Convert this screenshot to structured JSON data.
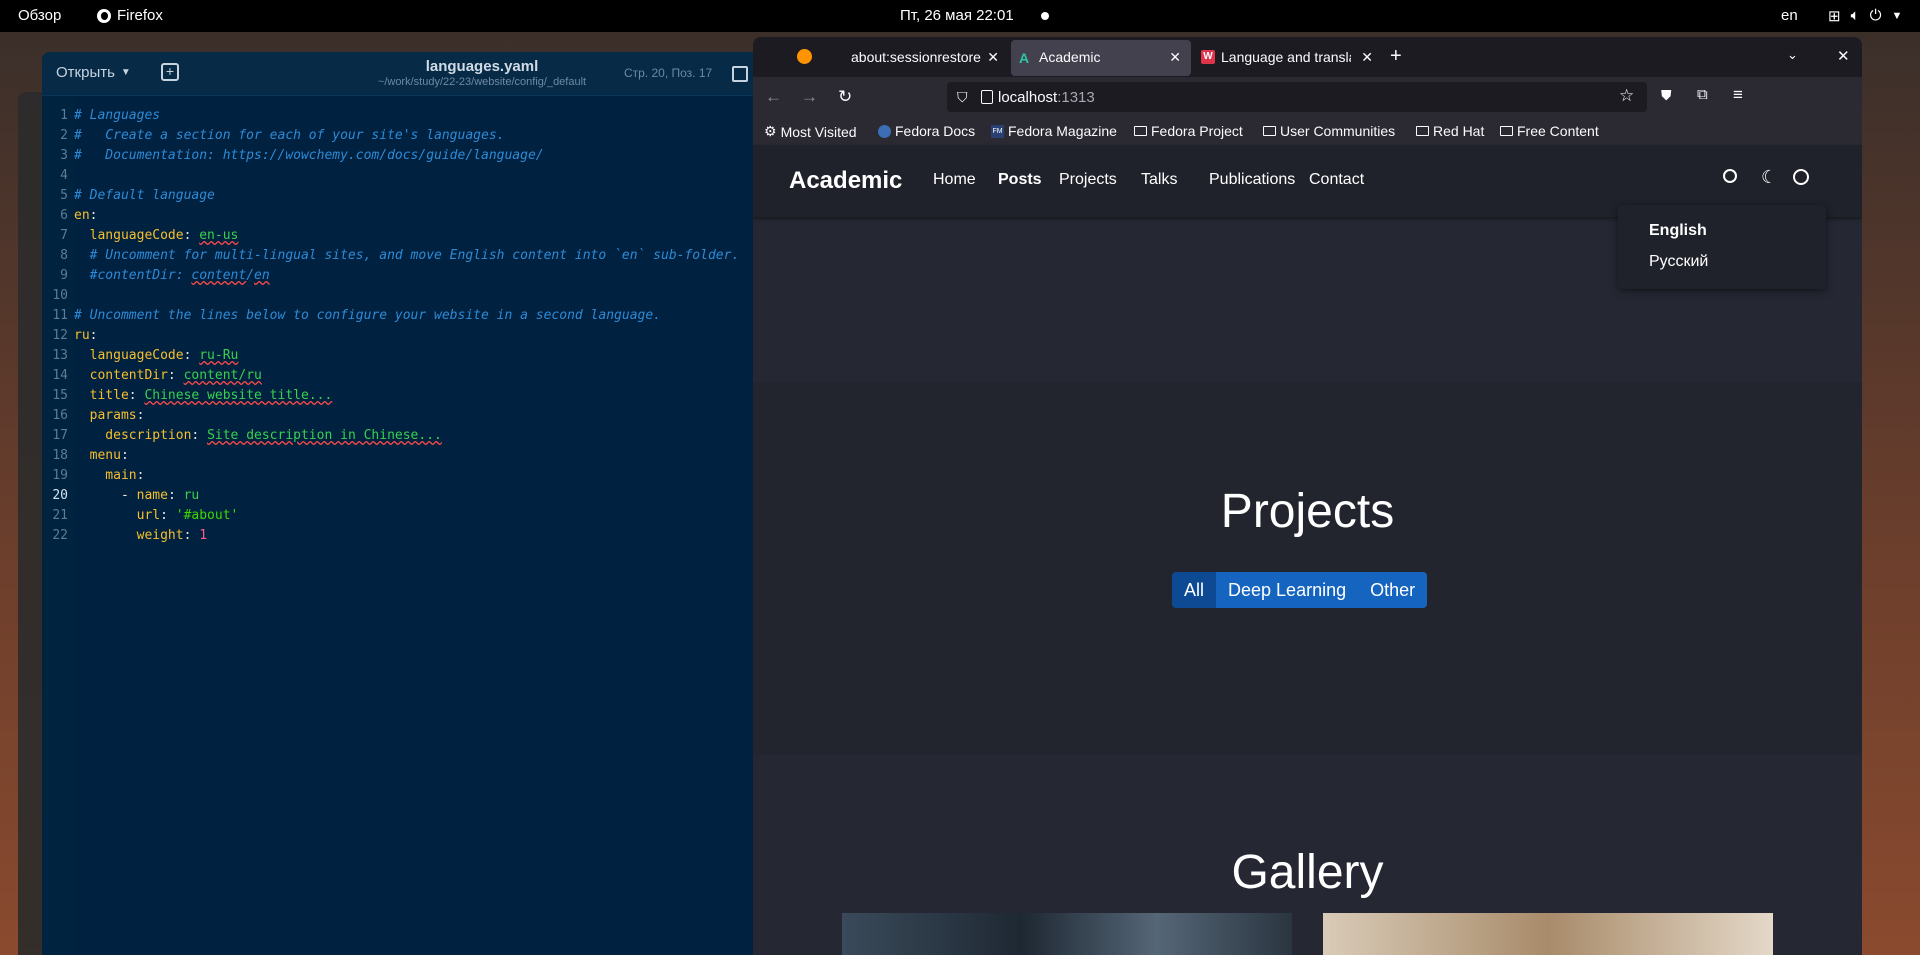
{
  "topbar": {
    "activities": "Обзор",
    "app_name": "Firefox",
    "clock": "Пт, 26 мая  22:01",
    "keyboard_layout": "en"
  },
  "gedit": {
    "open_label": "Открыть",
    "title": "languages.yaml",
    "path": "~/work/study/22-23/website/config/_default",
    "cursor_position": "Стр. 20, Поз. 17",
    "lines": [
      {
        "n": "1",
        "segments": [
          {
            "t": "# Languages",
            "c": "c-com"
          }
        ]
      },
      {
        "n": "2",
        "segments": [
          {
            "t": "#   Create a section for each of your site's languages.",
            "c": "c-com"
          }
        ]
      },
      {
        "n": "3",
        "segments": [
          {
            "t": "#   Documentation: https://wowchemy.com/docs/guide/language/",
            "c": "c-com"
          }
        ]
      },
      {
        "n": "4",
        "segments": []
      },
      {
        "n": "5",
        "segments": [
          {
            "t": "# Default language",
            "c": "c-com"
          }
        ]
      },
      {
        "n": "6",
        "segments": [
          {
            "t": "en",
            "c": "c-key"
          },
          {
            "t": ":",
            "c": "c-punct"
          }
        ]
      },
      {
        "n": "7",
        "segments": [
          {
            "t": "  languageCode",
            "c": "c-key"
          },
          {
            "t": ": ",
            "c": "c-punct"
          },
          {
            "t": "en-us",
            "c": "c-str c-u"
          }
        ]
      },
      {
        "n": "8",
        "segments": [
          {
            "t": "  # Uncomment for multi-lingual sites, and move English content into `en` sub-folder.",
            "c": "c-com"
          }
        ]
      },
      {
        "n": "9",
        "segments": [
          {
            "t": "  #contentDir: ",
            "c": "c-com"
          },
          {
            "t": "content",
            "c": "c-com c-u"
          },
          {
            "t": "/",
            "c": "c-com"
          },
          {
            "t": "en",
            "c": "c-com c-u"
          }
        ]
      },
      {
        "n": "10",
        "segments": []
      },
      {
        "n": "11",
        "segments": [
          {
            "t": "# Uncomment the lines below to configure your website in a second language.",
            "c": "c-com"
          }
        ]
      },
      {
        "n": "12",
        "segments": [
          {
            "t": "ru",
            "c": "c-key"
          },
          {
            "t": ":",
            "c": "c-punct"
          }
        ]
      },
      {
        "n": "13",
        "segments": [
          {
            "t": "  languageCode",
            "c": "c-key"
          },
          {
            "t": ": ",
            "c": "c-punct"
          },
          {
            "t": "ru-Ru",
            "c": "c-str c-u"
          }
        ]
      },
      {
        "n": "14",
        "segments": [
          {
            "t": "  contentDir",
            "c": "c-key"
          },
          {
            "t": ": ",
            "c": "c-punct"
          },
          {
            "t": "content/ru",
            "c": "c-str c-u"
          }
        ]
      },
      {
        "n": "15",
        "segments": [
          {
            "t": "  title",
            "c": "c-key"
          },
          {
            "t": ": ",
            "c": "c-punct"
          },
          {
            "t": "Chinese website title...",
            "c": "c-str c-u"
          }
        ]
      },
      {
        "n": "16",
        "segments": [
          {
            "t": "  params",
            "c": "c-key"
          },
          {
            "t": ":",
            "c": "c-punct"
          }
        ]
      },
      {
        "n": "17",
        "segments": [
          {
            "t": "    description",
            "c": "c-key"
          },
          {
            "t": ": ",
            "c": "c-punct"
          },
          {
            "t": "Site description in Chinese...",
            "c": "c-str c-u"
          }
        ]
      },
      {
        "n": "18",
        "segments": [
          {
            "t": "  menu",
            "c": "c-key"
          },
          {
            "t": ":",
            "c": "c-punct"
          }
        ]
      },
      {
        "n": "19",
        "segments": [
          {
            "t": "    main",
            "c": "c-key"
          },
          {
            "t": ":",
            "c": "c-punct"
          }
        ]
      },
      {
        "n": "20",
        "segments": [
          {
            "t": "      - ",
            "c": "c-punct"
          },
          {
            "t": "name",
            "c": "c-key"
          },
          {
            "t": ": ",
            "c": "c-punct"
          },
          {
            "t": "ru",
            "c": "c-str"
          }
        ],
        "current": true
      },
      {
        "n": "21",
        "segments": [
          {
            "t": "        url",
            "c": "c-key"
          },
          {
            "t": ": ",
            "c": "c-punct"
          },
          {
            "t": "'#about'",
            "c": "c-tick"
          }
        ]
      },
      {
        "n": "22",
        "segments": [
          {
            "t": "        weight",
            "c": "c-key"
          },
          {
            "t": ": ",
            "c": "c-punct"
          },
          {
            "t": "1",
            "c": "c-num"
          }
        ]
      }
    ]
  },
  "firefox": {
    "tabs": [
      {
        "title": "about:sessionrestore",
        "active": false
      },
      {
        "title": "Academic",
        "active": true
      },
      {
        "title": "Language and translation",
        "active": false
      }
    ],
    "url_host": "localhost",
    "url_port": ":1313",
    "bookmarks": [
      "Most Visited",
      "Fedora Docs",
      "Fedora Magazine",
      "Fedora Project",
      "User Communities",
      "Red Hat",
      "Free Content"
    ]
  },
  "site": {
    "brand": "Academic",
    "nav": [
      "Home",
      "Posts",
      "Projects",
      "Talks",
      "Publications",
      "Contact"
    ],
    "lang_menu": [
      "English",
      "Русский"
    ],
    "projects_title": "Projects",
    "filters": [
      "All",
      "Deep Learning",
      "Other"
    ],
    "gallery_title": "Gallery"
  },
  "colors": {
    "editor_bg": "#002240",
    "firefox_chrome": "#2b2a33",
    "site_bg": "#252833",
    "filter_blue": "#1565c0"
  }
}
